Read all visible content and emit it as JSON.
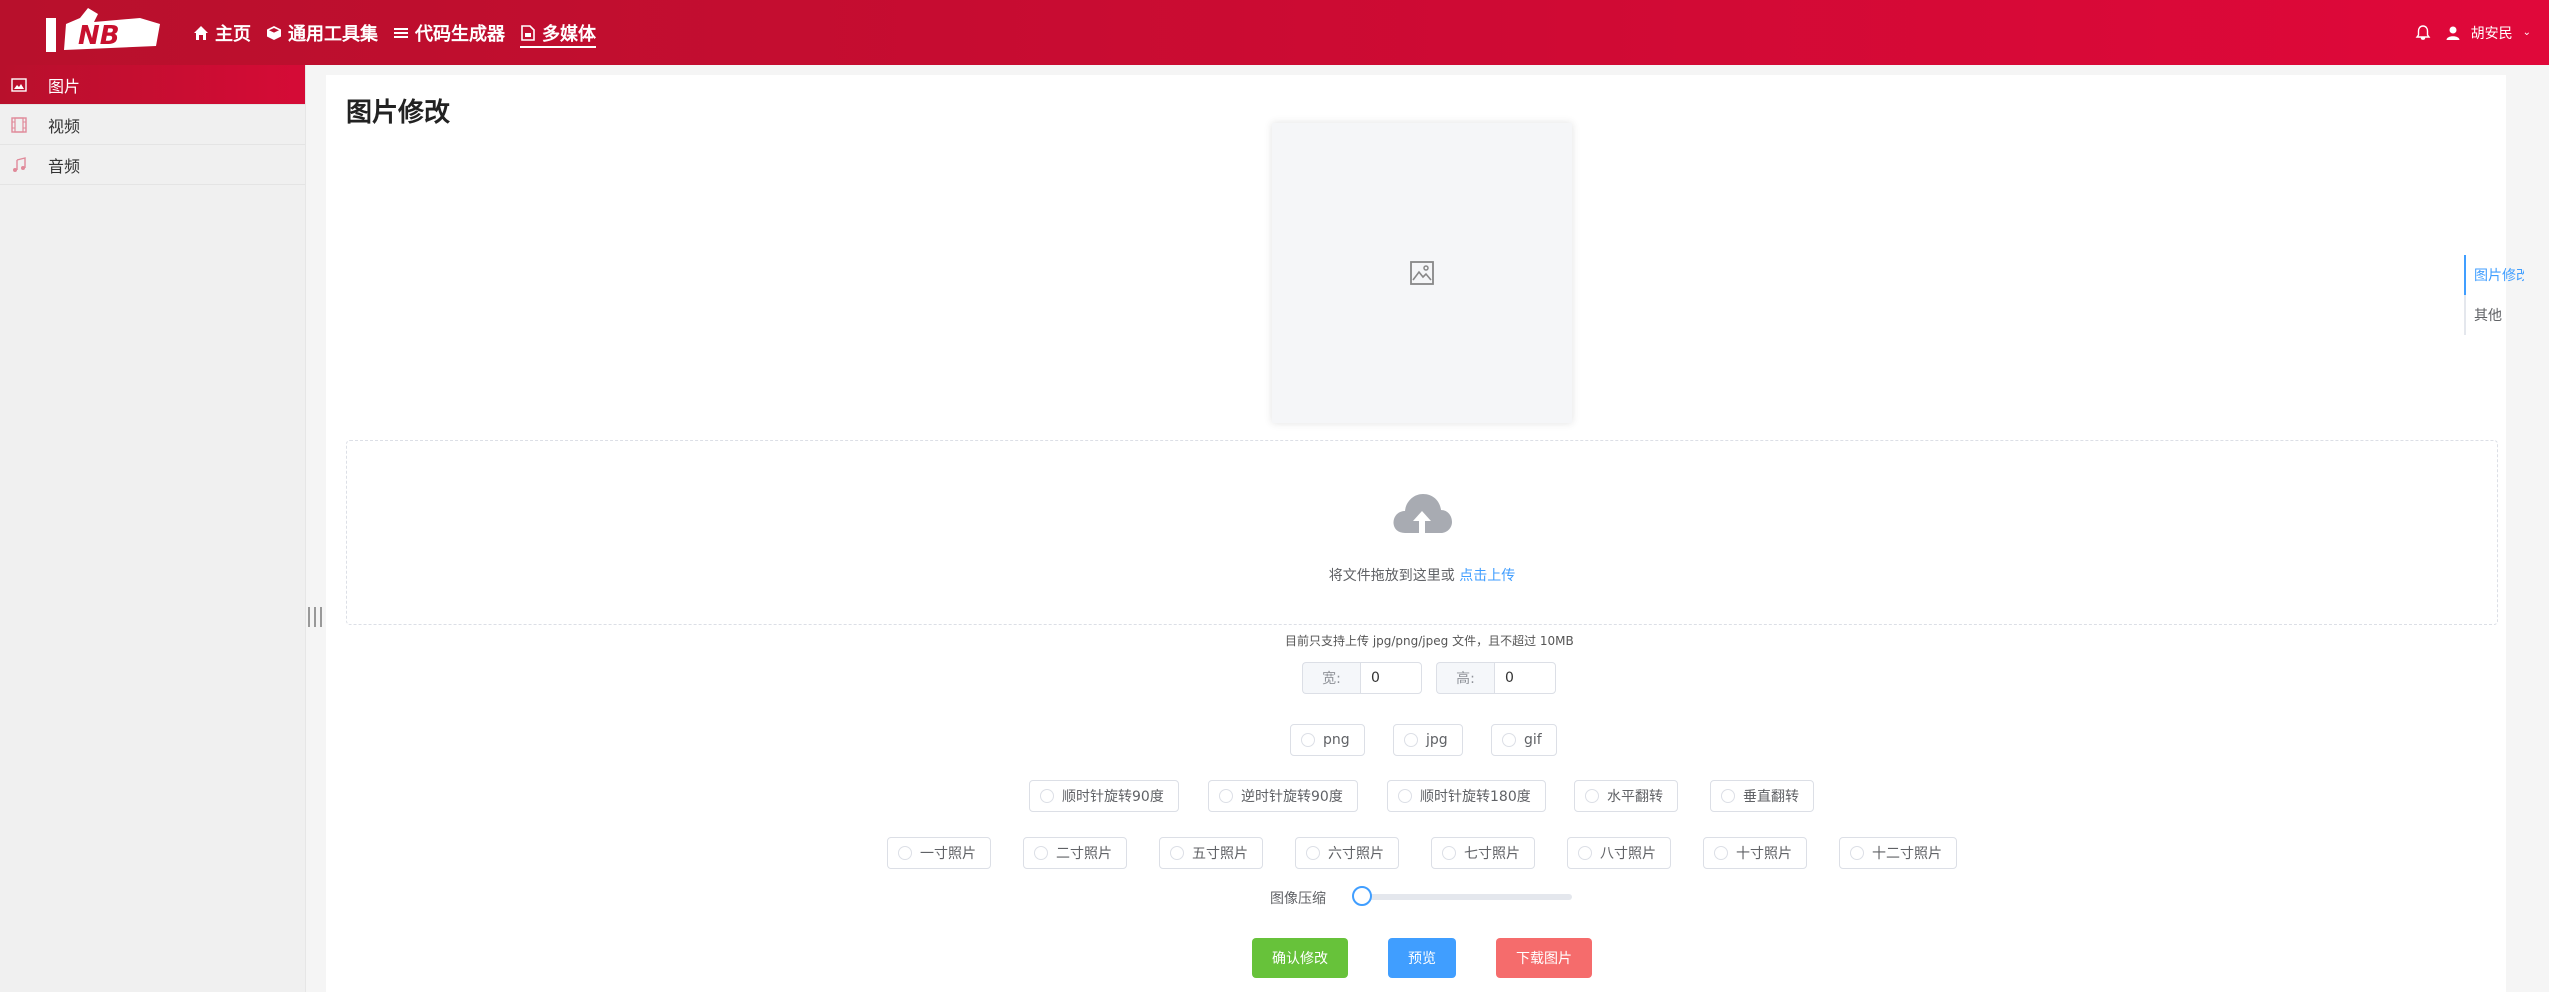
{
  "header": {
    "nav": [
      {
        "label": "主页",
        "icon": "home-icon"
      },
      {
        "label": "通用工具集",
        "icon": "cube-icon"
      },
      {
        "label": "代码生成器",
        "icon": "list-icon"
      },
      {
        "label": "多媒体",
        "icon": "media-icon",
        "active": true
      }
    ],
    "user": {
      "name": "胡安民"
    }
  },
  "sidebar": {
    "items": [
      {
        "label": "图片",
        "icon": "image-icon",
        "active": true
      },
      {
        "label": "视频",
        "icon": "film-icon"
      },
      {
        "label": "音频",
        "icon": "music-icon"
      }
    ]
  },
  "main": {
    "title": "图片修改",
    "upload": {
      "text": "将文件拖放到这里或 ",
      "link": "点击上传"
    },
    "tip": "目前只支持上传 jpg/png/jpeg 文件，且不超过 10MB",
    "size": {
      "width_label": "宽:",
      "width_value": "0",
      "height_label": "高:",
      "height_value": "0"
    },
    "formats": [
      "png",
      "jpg",
      "gif"
    ],
    "transforms": [
      "顺时针旋转90度",
      "逆时针旋转90度",
      "顺时针旋转180度",
      "水平翻转",
      "垂直翻转"
    ],
    "photo_sizes": [
      "一寸照片",
      "二寸照片",
      "五寸照片",
      "六寸照片",
      "七寸照片",
      "八寸照片",
      "十寸照片",
      "十二寸照片"
    ],
    "compress": {
      "label": "图像压缩",
      "value": 0
    },
    "buttons": {
      "confirm": "确认修改",
      "preview": "预览",
      "download": "下载图片"
    }
  },
  "anchor": {
    "items": [
      "图片修改",
      "其他"
    ],
    "active": 0
  },
  "colors": {
    "brand": "#c8102e",
    "primary": "#409eff",
    "success": "#67c23a",
    "danger": "#f56c6c"
  }
}
